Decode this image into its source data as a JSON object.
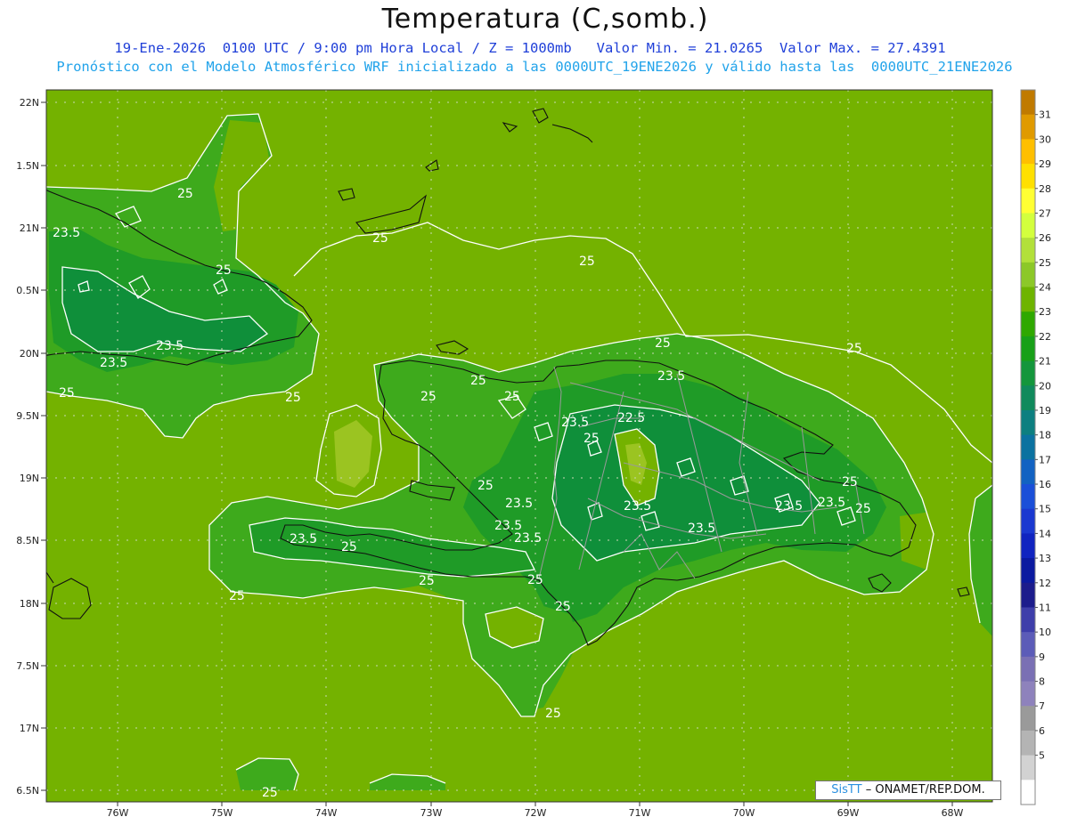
{
  "header": {
    "title": "Temperatura (C,somb.)",
    "line1": "19-Ene-2026  0100 UTC / 9:00 pm Hora Local / Z = 1000mb   Valor Min. = 21.0265  Valor Max. = 27.4391",
    "line2": "Pronóstico con el Modelo Atmosférico WRF inicializado a las 0000UTC_19ENE2026 y válido hasta las  0000UTC_21ENE2026"
  },
  "axes": {
    "lat_labels": [
      "22N",
      "1.5N",
      "21N",
      "0.5N",
      "20N",
      "9.5N",
      "19N",
      "8.5N",
      "18N",
      "7.5N",
      "17N",
      "6.5N"
    ],
    "lon_labels": [
      "76W",
      "75W",
      "74W",
      "73W",
      "72W",
      "71W",
      "70W",
      "69W",
      "68W"
    ]
  },
  "colorbar": {
    "labels": [
      "31",
      "30",
      "29",
      "28",
      "27",
      "26",
      "25",
      "24",
      "23",
      "22",
      "21",
      "20",
      "19",
      "18",
      "17",
      "16",
      "15",
      "14",
      "13",
      "12",
      "11",
      "10",
      "9",
      "8",
      "7",
      "6",
      "5"
    ],
    "colors": [
      "#c07a00",
      "#e09a00",
      "#ffbf00",
      "#ffe000",
      "#ffff33",
      "#d3ff3d",
      "#b2e03a",
      "#8cc828",
      "#6eb400",
      "#2fa800",
      "#18a018",
      "#14963c",
      "#108a5c",
      "#0d7f80",
      "#0b72a0",
      "#1262c2",
      "#1a4fd8",
      "#1a38d0",
      "#1024c0",
      "#0b1aa0",
      "#1c1c8c",
      "#3e3eaa",
      "#5c5cb8",
      "#7a70b4",
      "#8e82bc",
      "#9a9a9a",
      "#b4b4b4",
      "#d2d2d2",
      "#ffffff"
    ]
  },
  "contour_labels": [
    "25",
    "25",
    "23.5",
    "25",
    "25",
    "25",
    "23.5",
    "23.5",
    "25",
    "25",
    "25",
    "25",
    "25",
    "23.5",
    "23.5",
    "22.5",
    "25",
    "23.5",
    "25",
    "25",
    "23.5",
    "23.5",
    "23.5",
    "25",
    "23.5",
    "23.5",
    "23.5",
    "25",
    "23.5",
    "25",
    "25",
    "25",
    "25",
    "25",
    "25",
    "25"
  ],
  "credit": {
    "brand": "SisTT",
    "org": "– ONAMET/REP.DOM."
  }
}
